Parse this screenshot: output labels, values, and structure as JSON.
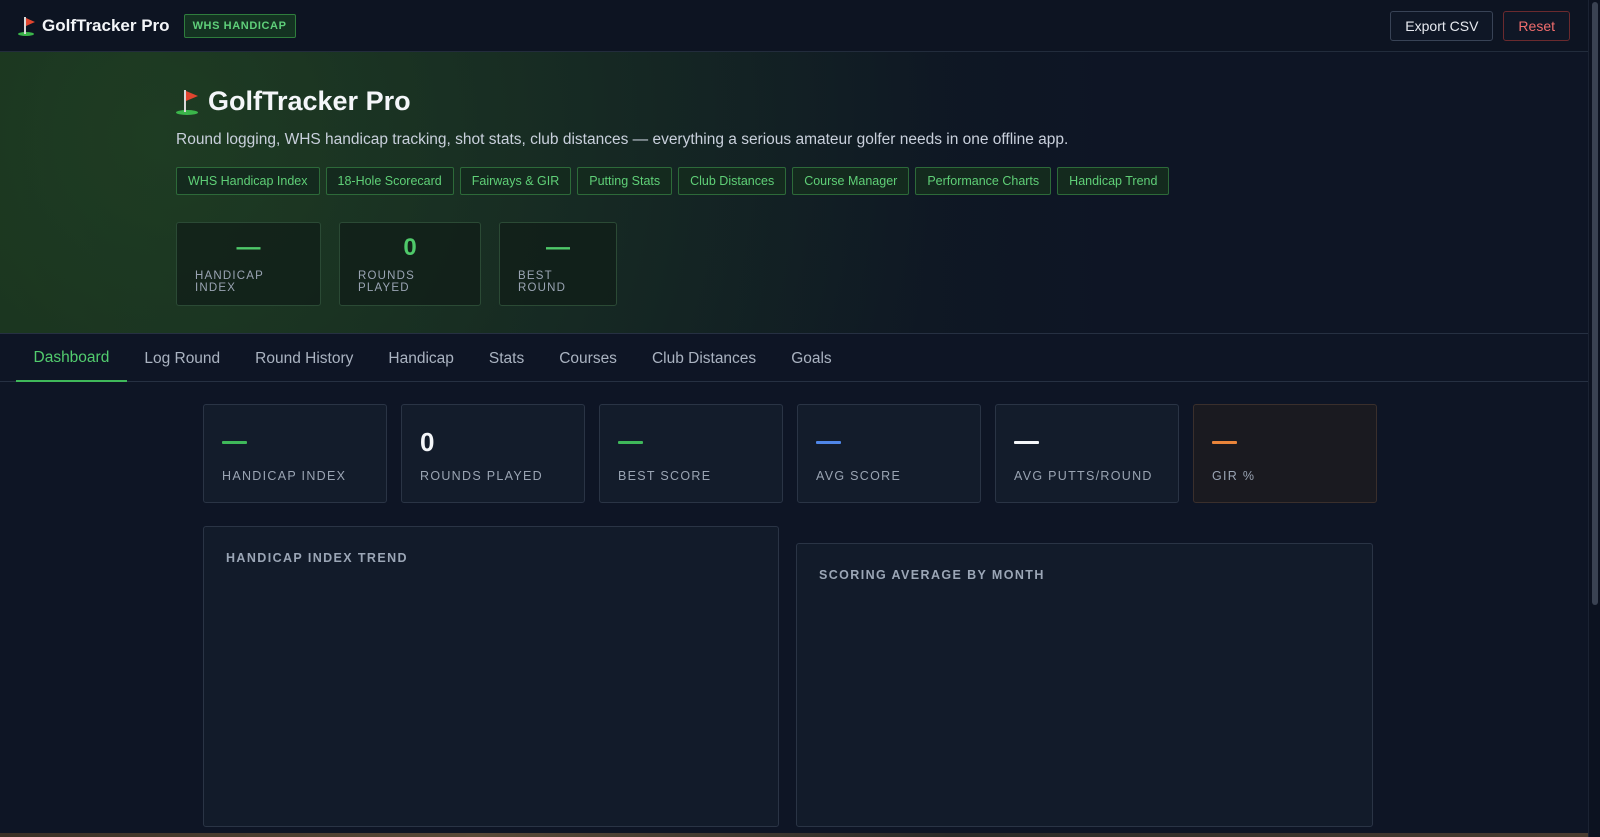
{
  "topbar": {
    "brand": "GolfTracker Pro",
    "badge": "WHS HANDICAP",
    "export_label": "Export CSV",
    "reset_label": "Reset"
  },
  "hero": {
    "title": "GolfTracker Pro",
    "subtitle": "Round logging, WHS handicap tracking, shot stats, club distances — everything a serious amateur golfer needs in one offline app.",
    "chips": [
      "WHS Handicap Index",
      "18-Hole Scorecard",
      "Fairways & GIR",
      "Putting Stats",
      "Club Distances",
      "Course Manager",
      "Performance Charts",
      "Handicap Trend"
    ],
    "stats": [
      {
        "value": "—",
        "label": "HANDICAP INDEX"
      },
      {
        "value": "0",
        "label": "ROUNDS PLAYED"
      },
      {
        "value": "—",
        "label": "BEST ROUND"
      }
    ]
  },
  "tabs": [
    "Dashboard",
    "Log Round",
    "Round History",
    "Handicap",
    "Stats",
    "Courses",
    "Club Distances",
    "Goals"
  ],
  "active_tab": "Dashboard",
  "cards": [
    {
      "value": "—",
      "label": "HANDICAP INDEX",
      "color": "#3fb85a"
    },
    {
      "value": "0",
      "label": "ROUNDS PLAYED",
      "color": "#f4f6f9"
    },
    {
      "value": "—",
      "label": "BEST SCORE",
      "color": "#3fb85a"
    },
    {
      "value": "—",
      "label": "AVG SCORE",
      "color": "#4f86e8"
    },
    {
      "value": "—",
      "label": "AVG PUTTS/ROUND",
      "color": "#f4f6f9"
    },
    {
      "value": "—",
      "label": "GIR %",
      "color": "#e9843a"
    }
  ],
  "panels": {
    "handicap_trend_title": "HANDICAP INDEX TREND",
    "scoring_avg_title": "SCORING AVERAGE BY MONTH"
  },
  "colors": {
    "accent_green": "#3fb85a",
    "background": "#0e1525",
    "reset_red": "#f16d6d"
  }
}
